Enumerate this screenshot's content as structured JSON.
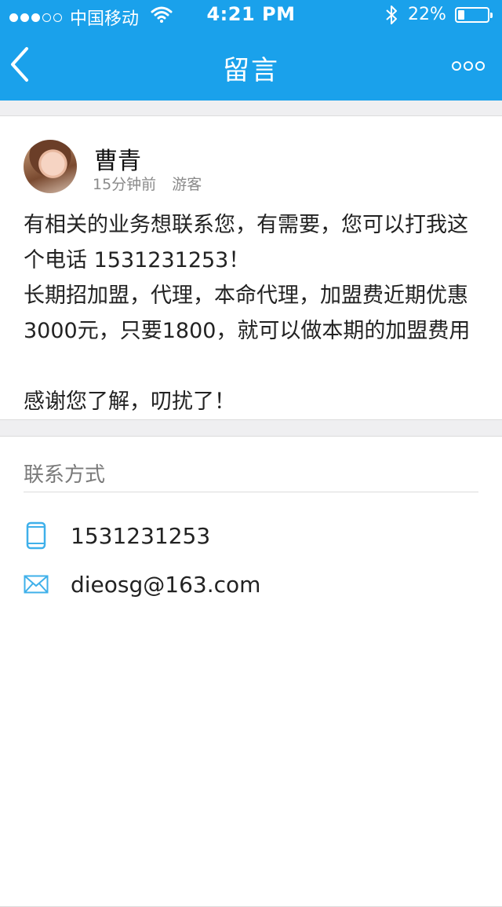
{
  "status_bar": {
    "carrier": "中国移动",
    "time": "4:21 PM",
    "battery": "22%",
    "battery_level": 0.22
  },
  "nav": {
    "title": "留言"
  },
  "message": {
    "author": "曹青",
    "time_ago": "15分钟前",
    "role": "游客",
    "body": "有相关的业务想联系您，有需要，您可以打我这个电话 1531231253！\n长期招加盟，代理，本命代理，加盟费近期优惠3000元，只要1800，就可以做本期的加盟费用\n\n感谢您了解，叨扰了！"
  },
  "contact": {
    "label": "联系方式",
    "phone": "1531231253",
    "email": "dieosg@163.com"
  },
  "colors": {
    "accent": "#1aa1eb",
    "icon": "#3fb0ea"
  }
}
